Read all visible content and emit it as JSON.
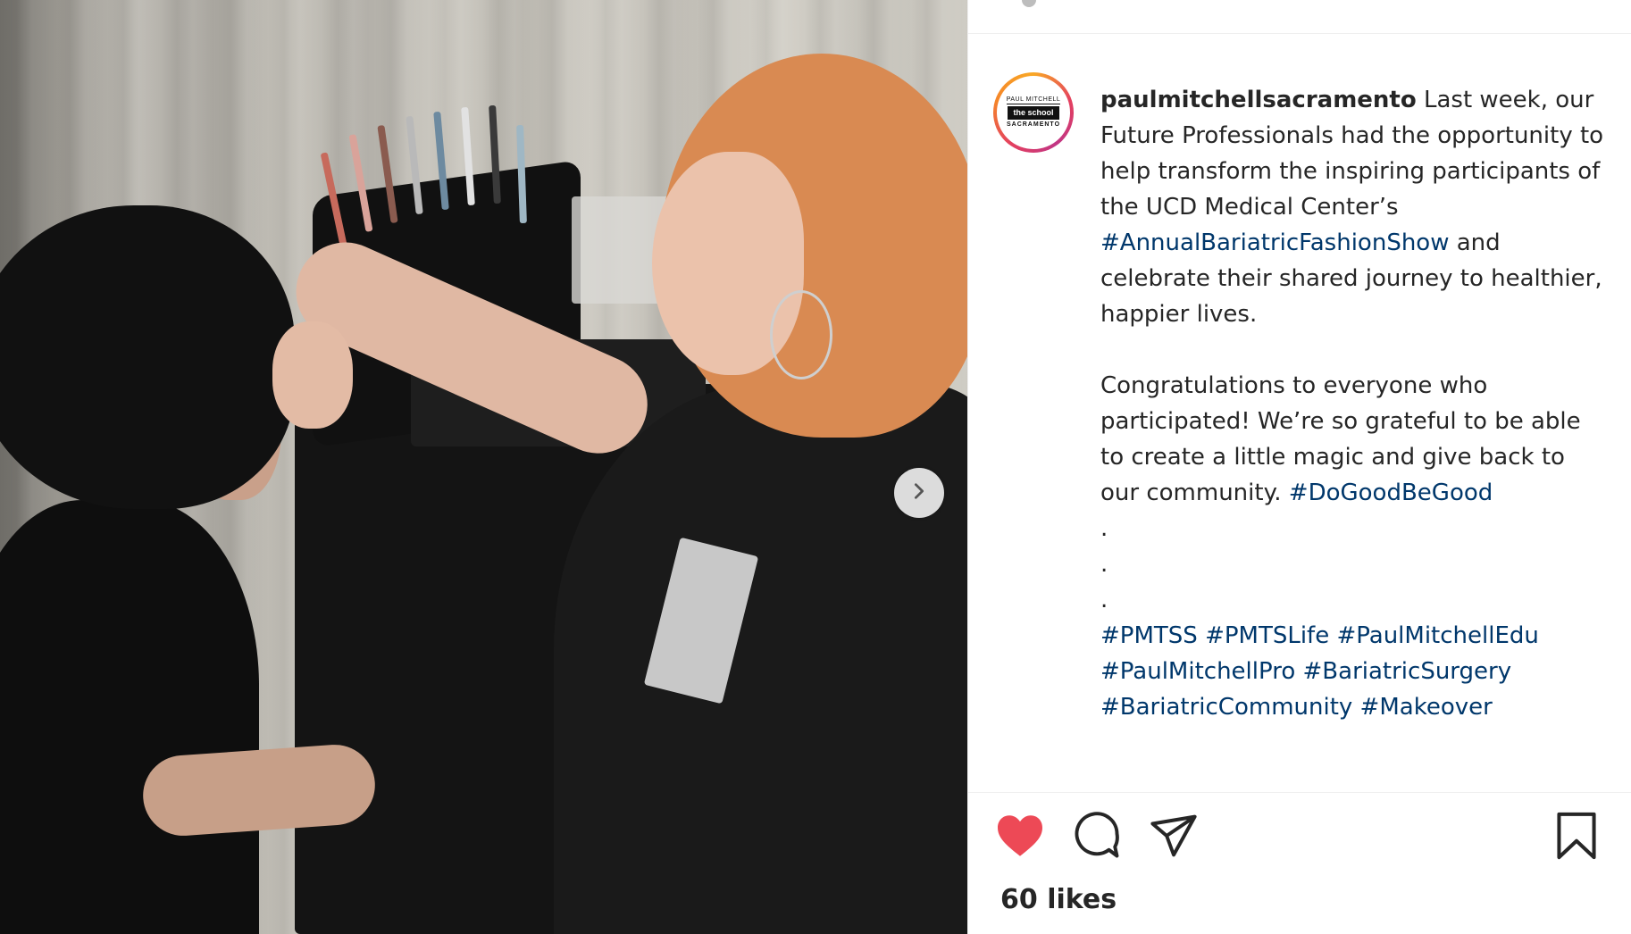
{
  "post": {
    "username": "paulmitchellsacramento",
    "avatar_text": {
      "line1": "PAUL MITCHELL",
      "line2": "the school",
      "line3": "SACRAMENTO"
    },
    "caption_paragraphs": [
      [
        {
          "type": "text",
          "value": " Last week, our Future Professionals had the opportunity to help transform the inspiring participants of the UCD Medical Center’s "
        },
        {
          "type": "hashtag",
          "value": "#AnnualBariatricFashionShow"
        },
        {
          "type": "text",
          "value": " and celebrate their shared journey to healthier, happier lives."
        }
      ],
      [
        {
          "type": "text",
          "value": "Congratulations to everyone who participated! We’re so grateful to be able to create a little magic and give back to our community. "
        },
        {
          "type": "hashtag",
          "value": "#DoGoodBeGood"
        }
      ]
    ],
    "dots": [
      ".",
      ".",
      "."
    ],
    "hashtags_block": [
      "#PMTSS",
      "#PMTSLife",
      "#PaulMitchellEdu",
      "#PaulMitchellPro",
      "#BariatricSurgery",
      "#BariatricCommunity",
      "#Makeover"
    ],
    "likes_text": "60 likes"
  },
  "icons": {
    "next": "chevron-right-icon",
    "like": "heart-filled-icon",
    "comment": "comment-bubble-icon",
    "share": "paper-plane-icon",
    "save": "bookmark-icon"
  },
  "colors": {
    "like_red": "#ed4956",
    "hashtag_blue": "#00376b",
    "text": "#262626"
  }
}
